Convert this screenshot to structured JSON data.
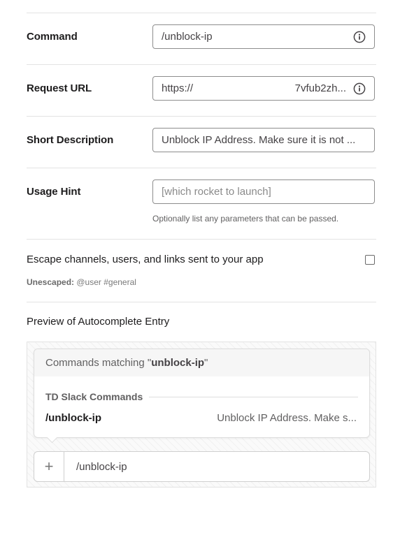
{
  "form": {
    "command": {
      "label": "Command",
      "value": "/unblock-ip",
      "info_icon": "info-icon"
    },
    "request_url": {
      "label": "Request URL",
      "value_start": "https://",
      "value_end": "7vfub2zh...",
      "info_icon": "info-icon"
    },
    "short_description": {
      "label": "Short Description",
      "value": "Unblock IP Address. Make sure it is not ..."
    },
    "usage_hint": {
      "label": "Usage Hint",
      "placeholder": "[which rocket to launch]",
      "help_text": "Optionally list any parameters that can be passed."
    },
    "escape": {
      "label": "Escape channels, users, and links sent to your app",
      "checked": false,
      "unescaped_label": "Unescaped:",
      "unescaped_value": "@user #general"
    }
  },
  "preview": {
    "title": "Preview of Autocomplete Entry",
    "header_prefix": "Commands matching \"",
    "header_query": "unblock-ip",
    "header_suffix": "\"",
    "group_name": "TD Slack Commands",
    "item": {
      "command": "/unblock-ip",
      "description": "Unblock IP Address. Make s..."
    },
    "input": {
      "plus_icon": "+",
      "text": "/unblock-ip"
    }
  }
}
